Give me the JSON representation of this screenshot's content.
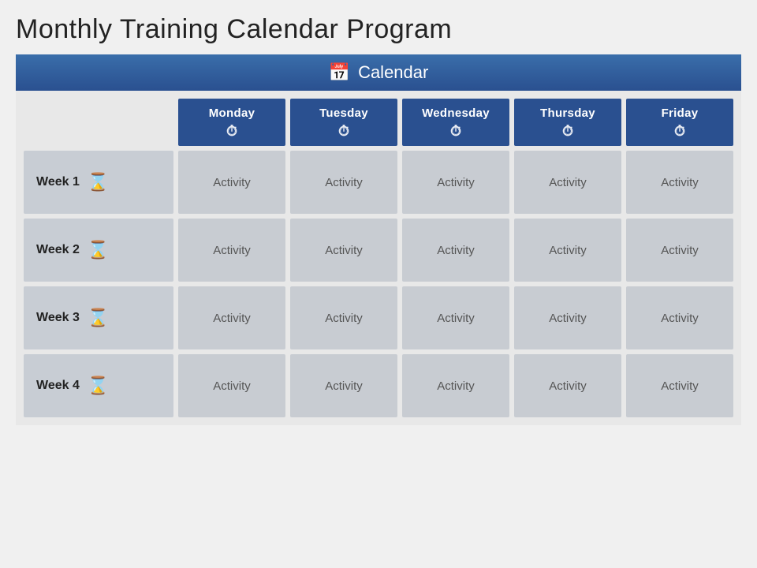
{
  "title": "Monthly Training Calendar Program",
  "header": {
    "icon": "📅",
    "label": "Calendar"
  },
  "days": [
    {
      "label": "Monday",
      "icon": "⏱"
    },
    {
      "label": "Tuesday",
      "icon": "⏱"
    },
    {
      "label": "Wednesday",
      "icon": "⏱"
    },
    {
      "label": "Thursday",
      "icon": "⏱"
    },
    {
      "label": "Friday",
      "icon": "⏱"
    }
  ],
  "weeks": [
    {
      "label": "Week 1",
      "activities": [
        "Activity",
        "Activity",
        "Activity",
        "Activity",
        "Activity"
      ]
    },
    {
      "label": "Week 2",
      "activities": [
        "Activity",
        "Activity",
        "Activity",
        "Activity",
        "Activity"
      ]
    },
    {
      "label": "Week 3",
      "activities": [
        "Activity",
        "Activity",
        "Activity",
        "Activity",
        "Activity"
      ]
    },
    {
      "label": "Week 4",
      "activities": [
        "Activity",
        "Activity",
        "Activity",
        "Activity",
        "Activity"
      ]
    }
  ],
  "colors": {
    "headerBg": "#2a5090",
    "dayHeaderBg": "#2a5090",
    "weekCellBg": "#c8cdd4",
    "activityCellBg": "#c8ccd2",
    "pageBg": "#f0f0f0"
  }
}
